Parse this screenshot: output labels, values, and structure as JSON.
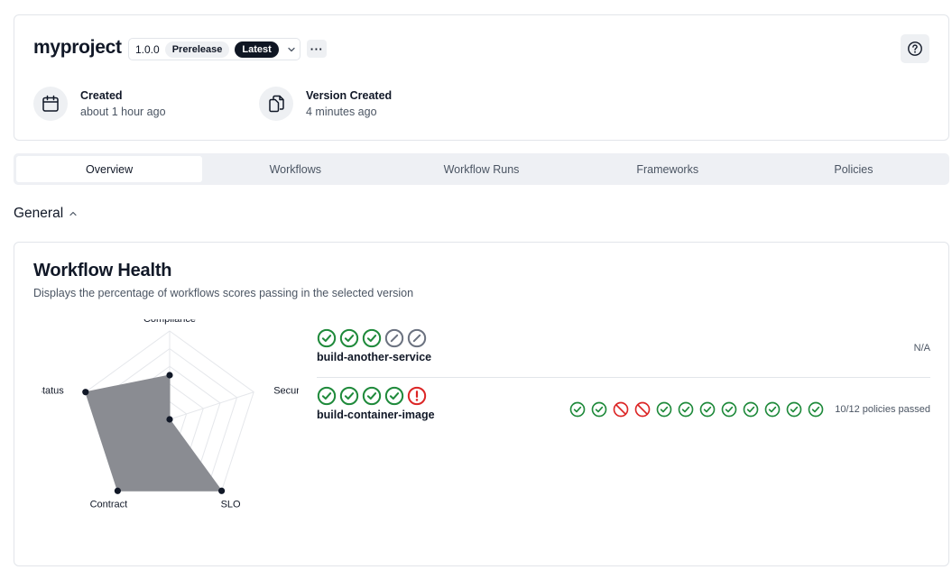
{
  "header": {
    "project_name": "myproject",
    "version": "1.0.0",
    "prerelease_badge": "Prerelease",
    "latest_badge": "Latest",
    "more_label": "···",
    "created_label": "Created",
    "created_value": "about 1 hour ago",
    "version_created_label": "Version Created",
    "version_created_value": "4 minutes ago"
  },
  "tabs": [
    {
      "label": "Overview",
      "active": true
    },
    {
      "label": "Workflows",
      "active": false
    },
    {
      "label": "Workflow Runs",
      "active": false
    },
    {
      "label": "Frameworks",
      "active": false
    },
    {
      "label": "Policies",
      "active": false
    }
  ],
  "section": {
    "title": "General"
  },
  "health": {
    "title": "Workflow Health",
    "subtitle": "Displays the percentage of workflows scores passing in the selected version",
    "radar": {
      "axes": [
        "Compliance",
        "Security",
        "SLO",
        "Contract",
        "Status"
      ],
      "values": [
        0.5,
        0.0,
        1.0,
        1.0,
        1.0
      ]
    },
    "workflows": [
      {
        "name": "build-another-service",
        "status_icons": [
          "check",
          "check",
          "check",
          "skip",
          "skip"
        ],
        "summary": "N/A",
        "policies": []
      },
      {
        "name": "build-container-image",
        "status_icons": [
          "check",
          "check",
          "check",
          "check",
          "alert"
        ],
        "summary": "10/12 policies passed",
        "policies": [
          "pass",
          "pass",
          "fail",
          "fail",
          "pass",
          "pass",
          "pass",
          "pass",
          "pass",
          "pass",
          "pass",
          "pass"
        ]
      }
    ]
  },
  "colors": {
    "pass": "#1f8a3b",
    "fail": "#dc2626",
    "skip": "#6b7280",
    "radar_fill": "#8a8c92"
  }
}
